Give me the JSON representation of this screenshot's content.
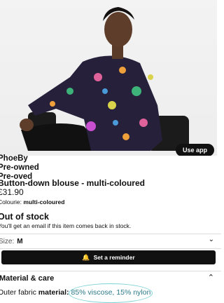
{
  "product": {
    "brand": "PhoeBy",
    "line2": "Pre-owned",
    "line3": "Pre-oved",
    "name": "Button-down blouse - multi-coloured",
    "price": "£31.90",
    "colour_label": "Colourie:",
    "colour_value": "multi-coloured"
  },
  "app_button": "Use app",
  "stock": {
    "title": "Out of stock",
    "subtitle": "You'll get an email if this item comes back in stock."
  },
  "size": {
    "label": "Size:",
    "value": "M"
  },
  "reminder_button": "Set a reminder",
  "material": {
    "heading": "Material & care",
    "prefix": "Outer fabric ",
    "label": "material:",
    "value": "85% viscose, 15% nylon"
  },
  "icons": {
    "bell": "bell-icon",
    "chevron": "chevron-down-icon"
  }
}
